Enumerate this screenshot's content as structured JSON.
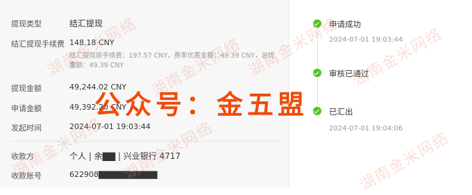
{
  "details": {
    "type_label": "提现类型",
    "type_value": "结汇提现",
    "fee_label": "结汇提现手续费",
    "fee_value": "148.18 CNY",
    "fee_note_line1": "结汇提现原手续费：197.57 CNY，费率优惠金额：49.39 CNY，总优惠",
    "fee_note_line2": "金额：49.39 CNY",
    "amount_label": "提现金额",
    "amount_value": "49,244.02 CNY",
    "apply_label": "申请金额",
    "apply_value": "49,392.20 CNY",
    "time_label": "发起时间",
    "time_value": "2024-07-01 19:03:44",
    "payee_label": "收款方",
    "payee_value": "个人 | 余▇▇ | 兴业银行 4717",
    "account_label": "收款账号",
    "account_value": "622908▇▇▇▇▇▇▇▇▇▇"
  },
  "timeline": [
    {
      "title": "申请成功",
      "time": "2024-07-01 19:03:44"
    },
    {
      "title": "审核已通过",
      "time": ""
    },
    {
      "title": "已汇出",
      "time": "2024-07-01 19:04:06"
    }
  ],
  "watermark": "湖南金米网络",
  "banner": "公众号：金五盟",
  "colors": {
    "success": "#52c41a",
    "banner": "#f04a09"
  }
}
